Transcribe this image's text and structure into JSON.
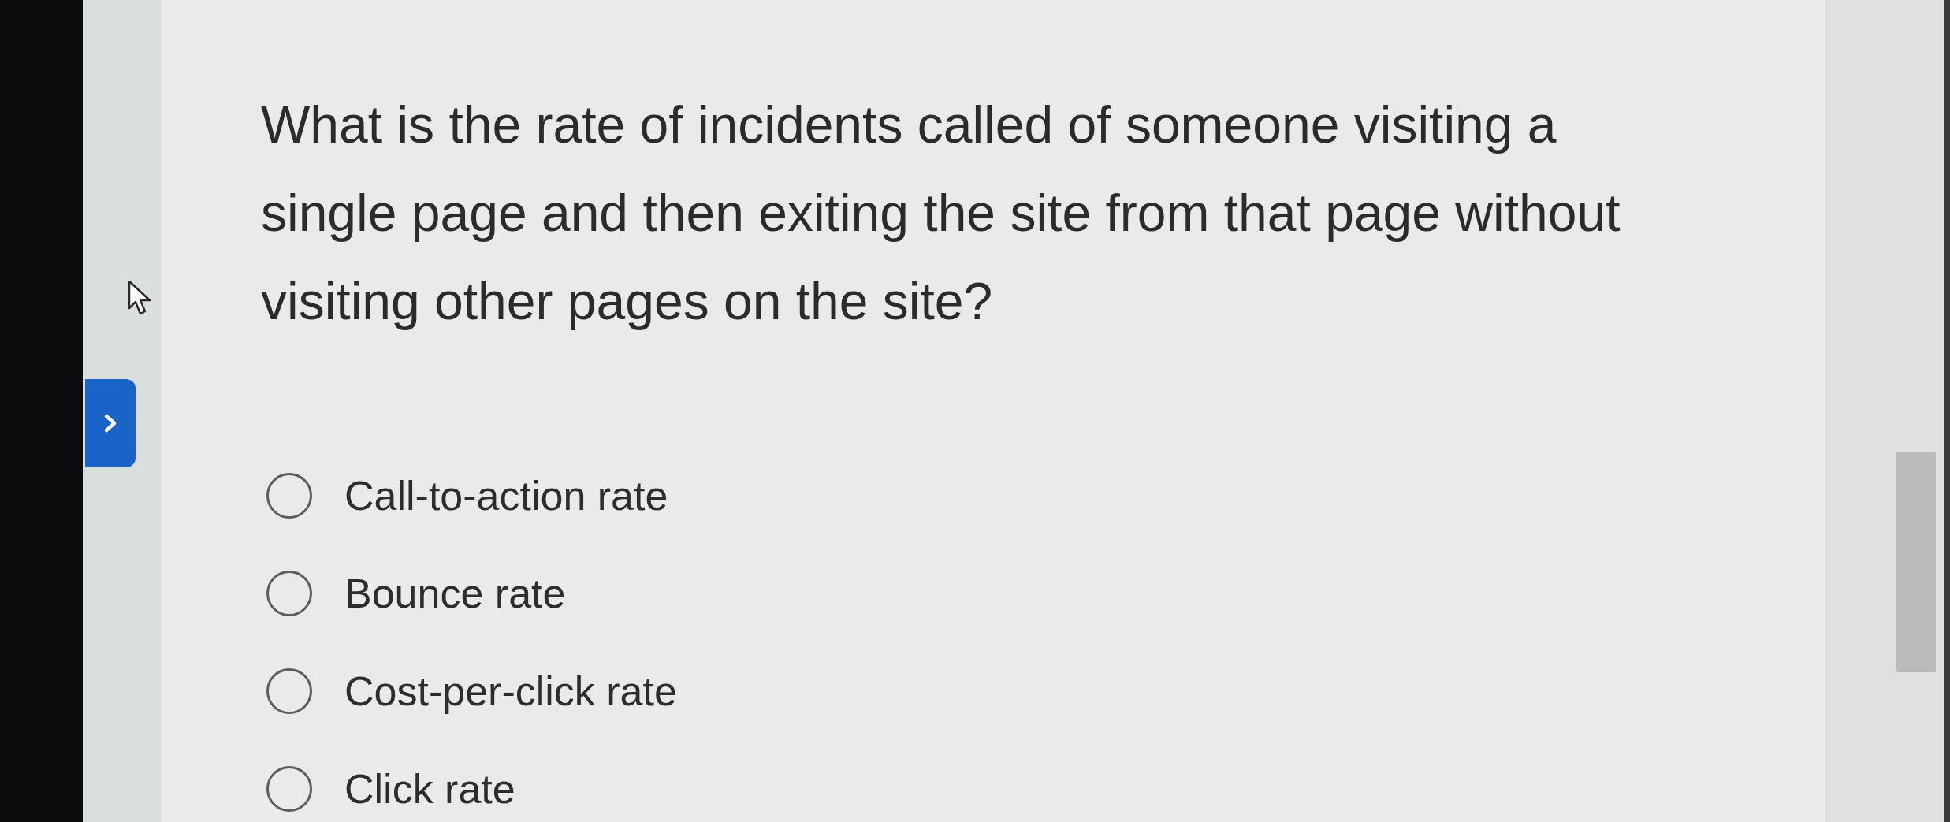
{
  "question": {
    "text": "What is the rate of incidents called of someone visiting a single page and then exiting the site from that page without visiting other pages on the site?"
  },
  "options": [
    {
      "label": "Call-to-action rate",
      "selected": false
    },
    {
      "label": "Bounce rate",
      "selected": false
    },
    {
      "label": "Cost-per-click rate",
      "selected": false
    },
    {
      "label": "Click rate",
      "selected": false
    }
  ]
}
